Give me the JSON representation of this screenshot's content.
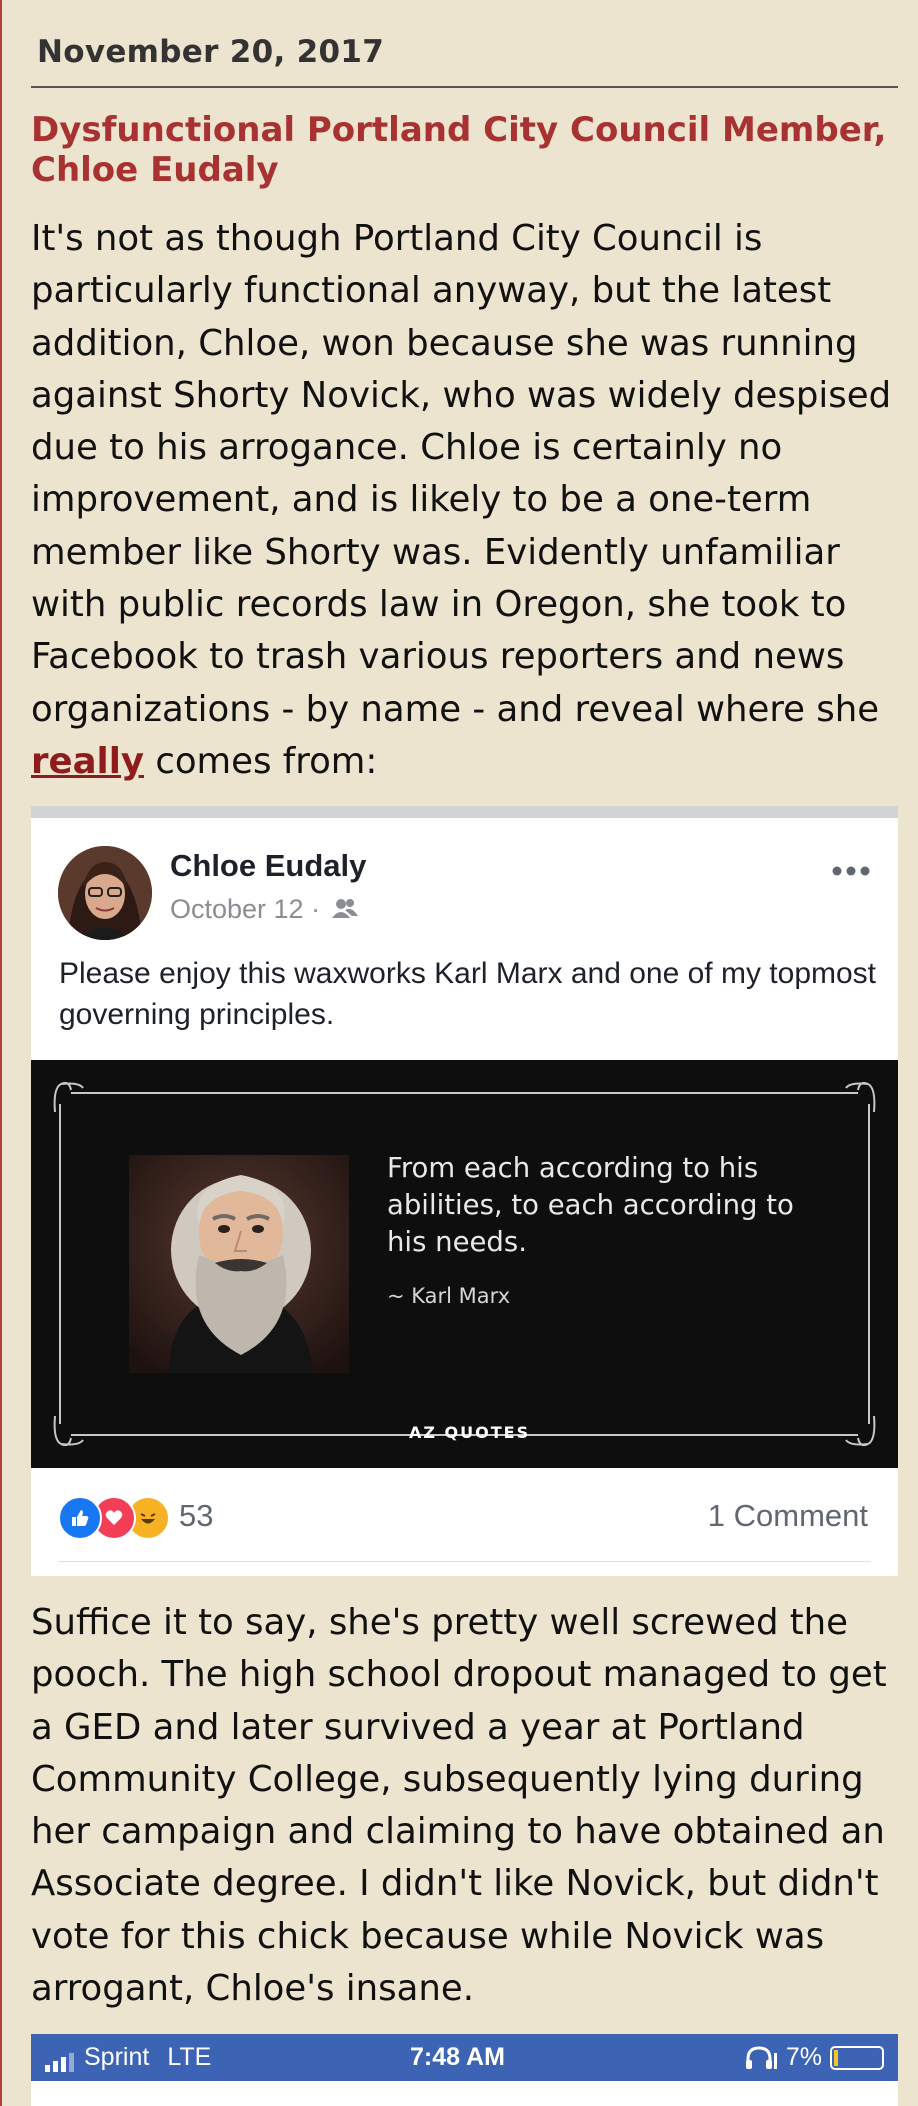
{
  "post": {
    "date": "November 20, 2017",
    "title": "Dysfunctional Portland City Council Member, Chloe Eudaly",
    "para1_before": "It's not as though Portland City Council is particularly functional anyway, but the latest addition, Chloe, won because she was running against Shorty Novick, who was widely despised due to his arrogance. Chloe is certainly no improvement, and is likely to be a one-term member like Shorty was. Evidently unfamiliar with public records law in Oregon, she took to Facebook to trash various reporters and news organizations - by name - and reveal where she ",
    "para1_link": "really",
    "para1_after": " comes from:",
    "para2": "Suffice it to say, she's pretty well screwed the pooch. The high school dropout managed to get a GED and later survived a year at Portland Community College, subsequently lying during her campaign and claiming to have obtained an Associate degree. I didn't like Novick, but didn't vote for this chick because while Novick was arrogant, Chloe's insane."
  },
  "facebook": {
    "author": "Chloe Eudaly",
    "date": "October 12 ·",
    "audience_icon": "friends-icon",
    "more_icon": "more-options-icon",
    "text": "Please enjoy this waxworks Karl Marx and one of my topmost governing principles.",
    "quote": "From each according to his abilities, to each according to his needs.",
    "quote_author": "~ Karl Marx",
    "quote_brand": "AZ QUOTES",
    "reaction_icons": [
      "like-icon",
      "love-icon",
      "haha-icon"
    ],
    "reaction_count": "53",
    "comment_count": "1 Comment",
    "colors": {
      "like": "#1877f2",
      "love": "#f33e58",
      "haha": "#f7b125"
    }
  },
  "status_bar": {
    "carrier": "Sprint",
    "network": "LTE",
    "time": "7:48 AM",
    "battery": "7%",
    "battery_level": 0.07,
    "icons": [
      "signal-icon",
      "headphones-icon",
      "battery-icon"
    ],
    "color": "#3d64b4"
  }
}
